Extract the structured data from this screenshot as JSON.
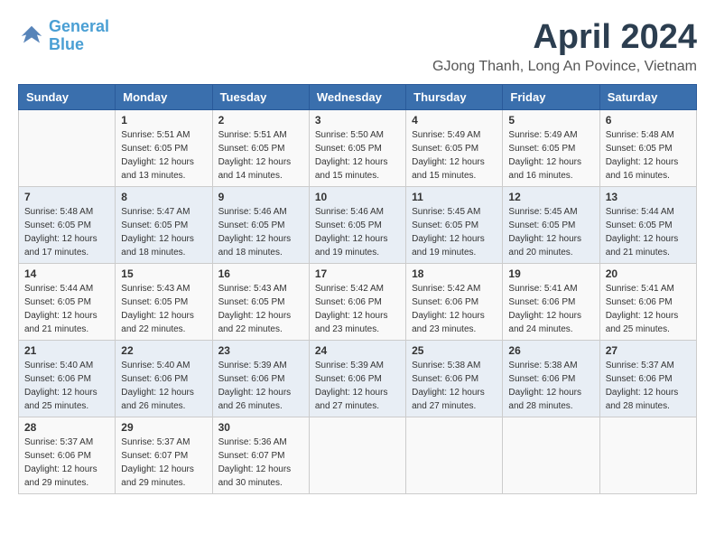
{
  "logo": {
    "text_general": "General",
    "text_blue": "Blue"
  },
  "header": {
    "title": "April 2024",
    "subtitle": "GJong Thanh, Long An Povince, Vietnam"
  },
  "weekdays": [
    "Sunday",
    "Monday",
    "Tuesday",
    "Wednesday",
    "Thursday",
    "Friday",
    "Saturday"
  ],
  "weeks": [
    [
      {
        "day": "",
        "sunrise": "",
        "sunset": "",
        "daylight": ""
      },
      {
        "day": "1",
        "sunrise": "Sunrise: 5:51 AM",
        "sunset": "Sunset: 6:05 PM",
        "daylight": "Daylight: 12 hours and 13 minutes."
      },
      {
        "day": "2",
        "sunrise": "Sunrise: 5:51 AM",
        "sunset": "Sunset: 6:05 PM",
        "daylight": "Daylight: 12 hours and 14 minutes."
      },
      {
        "day": "3",
        "sunrise": "Sunrise: 5:50 AM",
        "sunset": "Sunset: 6:05 PM",
        "daylight": "Daylight: 12 hours and 15 minutes."
      },
      {
        "day": "4",
        "sunrise": "Sunrise: 5:49 AM",
        "sunset": "Sunset: 6:05 PM",
        "daylight": "Daylight: 12 hours and 15 minutes."
      },
      {
        "day": "5",
        "sunrise": "Sunrise: 5:49 AM",
        "sunset": "Sunset: 6:05 PM",
        "daylight": "Daylight: 12 hours and 16 minutes."
      },
      {
        "day": "6",
        "sunrise": "Sunrise: 5:48 AM",
        "sunset": "Sunset: 6:05 PM",
        "daylight": "Daylight: 12 hours and 16 minutes."
      }
    ],
    [
      {
        "day": "7",
        "sunrise": "Sunrise: 5:48 AM",
        "sunset": "Sunset: 6:05 PM",
        "daylight": "Daylight: 12 hours and 17 minutes."
      },
      {
        "day": "8",
        "sunrise": "Sunrise: 5:47 AM",
        "sunset": "Sunset: 6:05 PM",
        "daylight": "Daylight: 12 hours and 18 minutes."
      },
      {
        "day": "9",
        "sunrise": "Sunrise: 5:46 AM",
        "sunset": "Sunset: 6:05 PM",
        "daylight": "Daylight: 12 hours and 18 minutes."
      },
      {
        "day": "10",
        "sunrise": "Sunrise: 5:46 AM",
        "sunset": "Sunset: 6:05 PM",
        "daylight": "Daylight: 12 hours and 19 minutes."
      },
      {
        "day": "11",
        "sunrise": "Sunrise: 5:45 AM",
        "sunset": "Sunset: 6:05 PM",
        "daylight": "Daylight: 12 hours and 19 minutes."
      },
      {
        "day": "12",
        "sunrise": "Sunrise: 5:45 AM",
        "sunset": "Sunset: 6:05 PM",
        "daylight": "Daylight: 12 hours and 20 minutes."
      },
      {
        "day": "13",
        "sunrise": "Sunrise: 5:44 AM",
        "sunset": "Sunset: 6:05 PM",
        "daylight": "Daylight: 12 hours and 21 minutes."
      }
    ],
    [
      {
        "day": "14",
        "sunrise": "Sunrise: 5:44 AM",
        "sunset": "Sunset: 6:05 PM",
        "daylight": "Daylight: 12 hours and 21 minutes."
      },
      {
        "day": "15",
        "sunrise": "Sunrise: 5:43 AM",
        "sunset": "Sunset: 6:05 PM",
        "daylight": "Daylight: 12 hours and 22 minutes."
      },
      {
        "day": "16",
        "sunrise": "Sunrise: 5:43 AM",
        "sunset": "Sunset: 6:05 PM",
        "daylight": "Daylight: 12 hours and 22 minutes."
      },
      {
        "day": "17",
        "sunrise": "Sunrise: 5:42 AM",
        "sunset": "Sunset: 6:06 PM",
        "daylight": "Daylight: 12 hours and 23 minutes."
      },
      {
        "day": "18",
        "sunrise": "Sunrise: 5:42 AM",
        "sunset": "Sunset: 6:06 PM",
        "daylight": "Daylight: 12 hours and 23 minutes."
      },
      {
        "day": "19",
        "sunrise": "Sunrise: 5:41 AM",
        "sunset": "Sunset: 6:06 PM",
        "daylight": "Daylight: 12 hours and 24 minutes."
      },
      {
        "day": "20",
        "sunrise": "Sunrise: 5:41 AM",
        "sunset": "Sunset: 6:06 PM",
        "daylight": "Daylight: 12 hours and 25 minutes."
      }
    ],
    [
      {
        "day": "21",
        "sunrise": "Sunrise: 5:40 AM",
        "sunset": "Sunset: 6:06 PM",
        "daylight": "Daylight: 12 hours and 25 minutes."
      },
      {
        "day": "22",
        "sunrise": "Sunrise: 5:40 AM",
        "sunset": "Sunset: 6:06 PM",
        "daylight": "Daylight: 12 hours and 26 minutes."
      },
      {
        "day": "23",
        "sunrise": "Sunrise: 5:39 AM",
        "sunset": "Sunset: 6:06 PM",
        "daylight": "Daylight: 12 hours and 26 minutes."
      },
      {
        "day": "24",
        "sunrise": "Sunrise: 5:39 AM",
        "sunset": "Sunset: 6:06 PM",
        "daylight": "Daylight: 12 hours and 27 minutes."
      },
      {
        "day": "25",
        "sunrise": "Sunrise: 5:38 AM",
        "sunset": "Sunset: 6:06 PM",
        "daylight": "Daylight: 12 hours and 27 minutes."
      },
      {
        "day": "26",
        "sunrise": "Sunrise: 5:38 AM",
        "sunset": "Sunset: 6:06 PM",
        "daylight": "Daylight: 12 hours and 28 minutes."
      },
      {
        "day": "27",
        "sunrise": "Sunrise: 5:37 AM",
        "sunset": "Sunset: 6:06 PM",
        "daylight": "Daylight: 12 hours and 28 minutes."
      }
    ],
    [
      {
        "day": "28",
        "sunrise": "Sunrise: 5:37 AM",
        "sunset": "Sunset: 6:06 PM",
        "daylight": "Daylight: 12 hours and 29 minutes."
      },
      {
        "day": "29",
        "sunrise": "Sunrise: 5:37 AM",
        "sunset": "Sunset: 6:07 PM",
        "daylight": "Daylight: 12 hours and 29 minutes."
      },
      {
        "day": "30",
        "sunrise": "Sunrise: 5:36 AM",
        "sunset": "Sunset: 6:07 PM",
        "daylight": "Daylight: 12 hours and 30 minutes."
      },
      {
        "day": "",
        "sunrise": "",
        "sunset": "",
        "daylight": ""
      },
      {
        "day": "",
        "sunrise": "",
        "sunset": "",
        "daylight": ""
      },
      {
        "day": "",
        "sunrise": "",
        "sunset": "",
        "daylight": ""
      },
      {
        "day": "",
        "sunrise": "",
        "sunset": "",
        "daylight": ""
      }
    ]
  ]
}
